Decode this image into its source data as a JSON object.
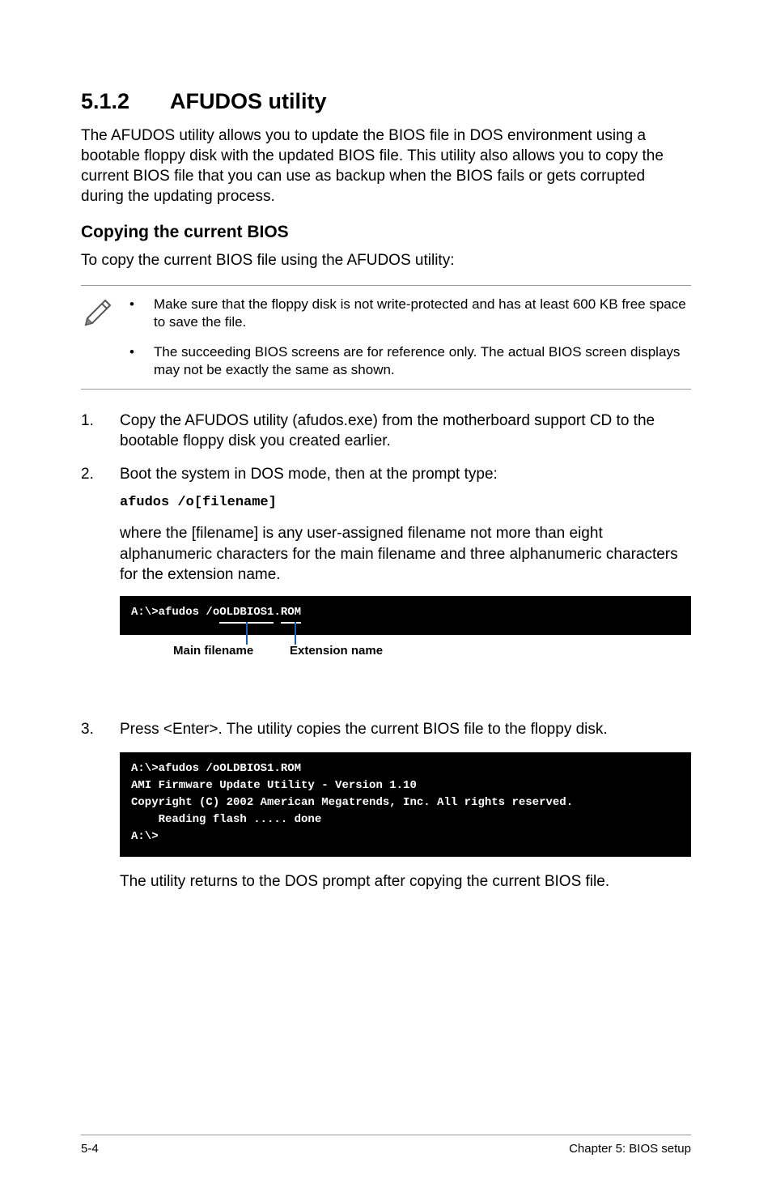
{
  "section": {
    "number": "5.1.2",
    "title": "AFUDOS utility"
  },
  "intro": "The AFUDOS utility allows you to update the BIOS file in DOS environment using a bootable floppy disk with the updated BIOS file. This utility also allows you to copy the current BIOS file that you can use as backup when the BIOS fails or gets corrupted during the updating process.",
  "sub1": {
    "heading": "Copying the current BIOS",
    "lead": "To copy the current BIOS file using the AFUDOS utility:"
  },
  "notes": [
    "Make sure that the floppy disk is not write-protected and has at least 600 KB free space to save the file.",
    "The succeeding BIOS screens are for reference only. The actual BIOS screen displays may not be exactly the same as shown."
  ],
  "steps": {
    "s1": {
      "num": "1.",
      "text": "Copy the AFUDOS utility (afudos.exe) from the motherboard support CD to the bootable floppy disk you created earlier."
    },
    "s2": {
      "num": "2.",
      "text": "Boot the system in DOS mode, then at the prompt type:"
    },
    "cmd": "afudos /o[filename]",
    "s2b": "where the [filename] is any user-assigned filename not more than eight alphanumeric characters  for the main filename and three alphanumeric characters for the extension name.",
    "term1_prefix": "A:\\>afudos /o",
    "term1_main": "OLDBIOS1",
    "term1_dot": ".",
    "term1_ext": "ROM",
    "annot_main": "Main filename",
    "annot_ext": "Extension name",
    "s3": {
      "num": "3.",
      "text": "Press <Enter>. The utility copies the current BIOS file to the floppy disk."
    },
    "term2": "A:\\>afudos /oOLDBIOS1.ROM\nAMI Firmware Update Utility - Version 1.10\nCopyright (C) 2002 American Megatrends, Inc. All rights reserved.\n    Reading flash ..... done\nA:\\>",
    "s3b": "The utility returns to the DOS prompt after copying the current BIOS file."
  },
  "footer": {
    "left": "5-4",
    "right": "Chapter 5: BIOS setup"
  }
}
